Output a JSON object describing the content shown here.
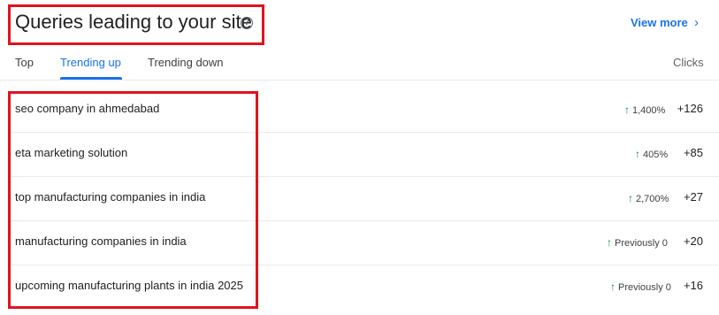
{
  "header": {
    "title": "Queries leading to your site",
    "help_icon": "help-circle-icon",
    "view_more": "View more",
    "chevron_icon": "chevron-right-icon"
  },
  "tabs": [
    {
      "label": "Top",
      "active": false
    },
    {
      "label": "Trending up",
      "active": true
    },
    {
      "label": "Trending down",
      "active": false
    }
  ],
  "columns": {
    "clicks": "Clicks"
  },
  "rows": [
    {
      "query": "seo company in ahmedabad",
      "trend": "1,400%",
      "clicks": "+126"
    },
    {
      "query": "eta marketing solution",
      "trend": "405%",
      "clicks": "+85"
    },
    {
      "query": "top manufacturing companies in india",
      "trend": "2,700%",
      "clicks": "+27"
    },
    {
      "query": "manufacturing companies in india",
      "trend": "Previously 0",
      "clicks": "+20"
    },
    {
      "query": "upcoming manufacturing plants in india 2025",
      "trend": "Previously 0",
      "clicks": "+16"
    }
  ],
  "colors": {
    "accent": "#1a73e8",
    "trend_up": "#188038",
    "highlight_border": "#e0131f"
  }
}
